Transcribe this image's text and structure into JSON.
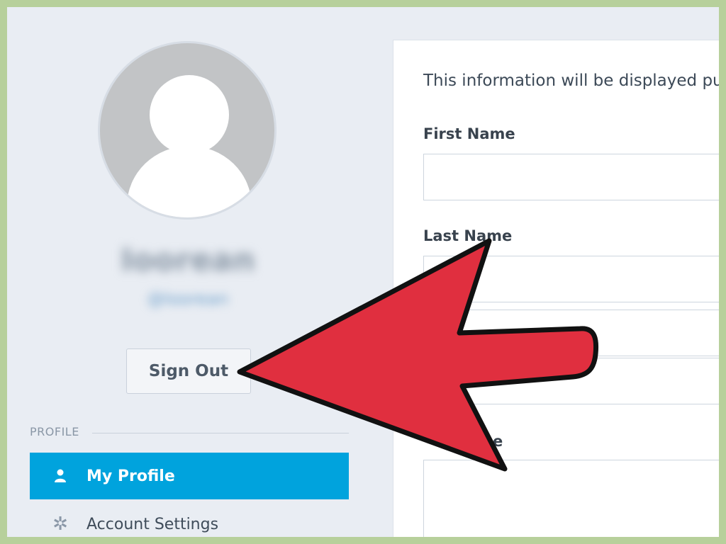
{
  "sidebar": {
    "username": "Ioorean",
    "handle": "@Ioorean",
    "signout_label": "Sign Out",
    "section_label": "PROFILE",
    "nav": [
      {
        "label": "My Profile",
        "icon": "person-icon",
        "active": true
      },
      {
        "label": "Account Settings",
        "icon": "gear-icon",
        "active": false
      }
    ]
  },
  "form": {
    "intro": "This information will be displayed pu",
    "first_name_label": "First Name",
    "first_name_value": "",
    "last_name_label": "Last Name",
    "last_name_value": "",
    "field3_value": "",
    "field4_value": "",
    "field5_label_fragment": "e",
    "field5_value": ""
  },
  "colors": {
    "accent": "#00a3dd",
    "arrow_fill": "#e02f3f",
    "frame_border": "#b7d09b"
  }
}
